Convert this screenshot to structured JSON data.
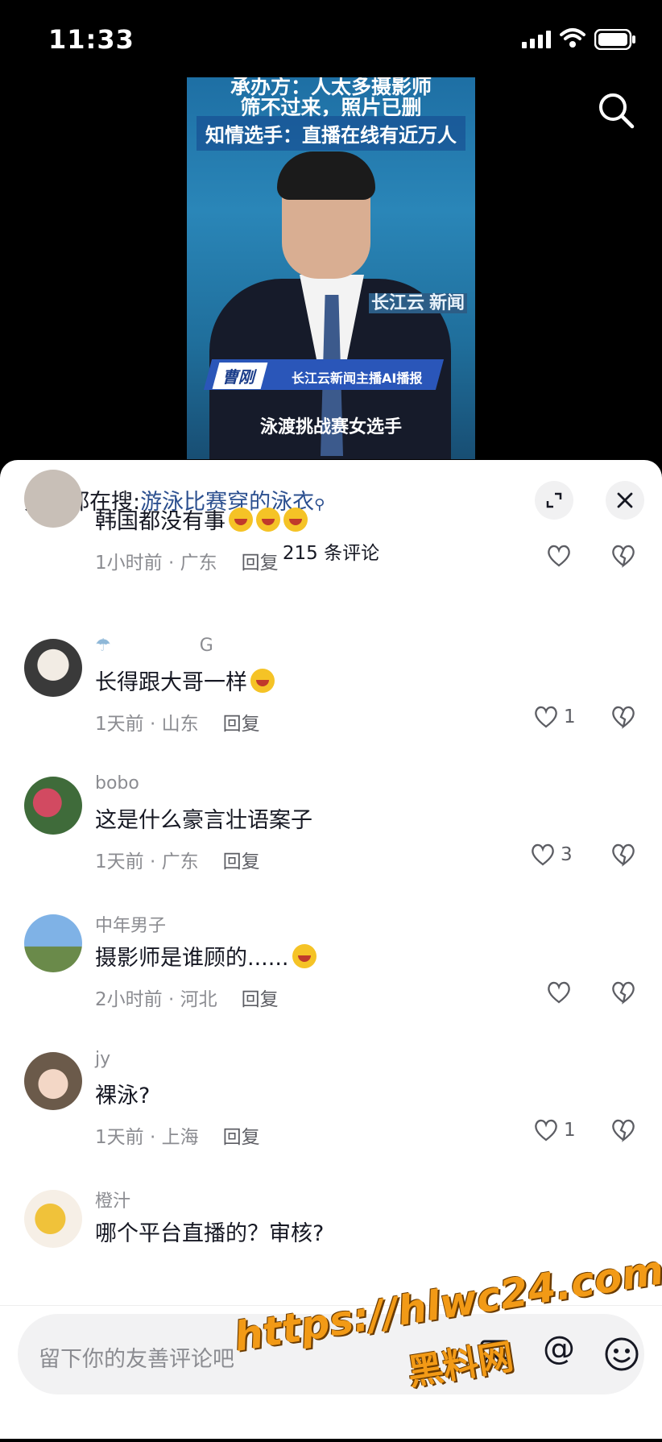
{
  "status_bar": {
    "time": "11:33"
  },
  "video": {
    "headline_partial": "承办方：人太多摄影师",
    "headline_line2": "筛不过来，照片已删",
    "headline_line3": "知情选手：直播在线有近万人",
    "channel_logo_text": "长江云",
    "channel_logo_badge": "新闻",
    "anchor_name": "曹刚",
    "anchor_title": "长江云新闻主播AI播报",
    "subtitle": "泳渡挑战赛女选手"
  },
  "panel": {
    "hot_search_prefix": "大家都在搜:",
    "hot_search_keyword": "游泳比赛穿的泳衣",
    "comment_count": "215 条评论"
  },
  "comments": [
    {
      "user": "",
      "text": "韩国都没有事",
      "time": "1小时前 · 广东",
      "reply": "回复",
      "likes": "",
      "emoji_count": 3
    },
    {
      "user": "G",
      "text": "长得跟大哥一样",
      "time": "1天前 · 山东",
      "reply": "回复",
      "likes": "1",
      "emoji_count": 1
    },
    {
      "user": "bobo",
      "text": "这是什么豪言壮语案子",
      "time": "1天前 · 广东",
      "reply": "回复",
      "likes": "3"
    },
    {
      "user": "中年男子",
      "text": "摄影师是谁顾的......",
      "time": "2小时前 · 河北",
      "reply": "回复",
      "likes": "",
      "emoji_count": 1
    },
    {
      "user": "jy",
      "text": "裸泳?",
      "time": "1天前 · 上海",
      "reply": "回复",
      "likes": "1"
    },
    {
      "user": "橙汁",
      "text": "哪个平台直播的？审核?",
      "time": "",
      "reply": "",
      "likes": ""
    }
  ],
  "input": {
    "placeholder": "留下你的友善评论吧"
  },
  "watermark": {
    "line1": "https://hlwc24.com",
    "line2": "黑料网"
  },
  "colors": {
    "accent": "#2b4f8f",
    "muted": "#8b8c91",
    "panel_bg": "#ffffff"
  }
}
